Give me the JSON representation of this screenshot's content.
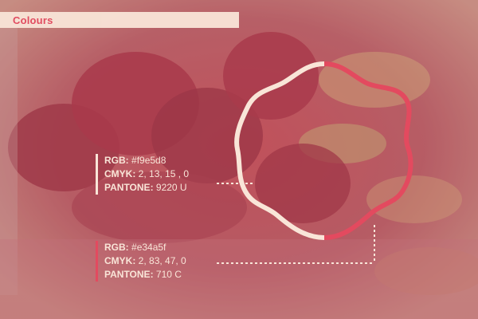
{
  "header": {
    "title": "Colours"
  },
  "swatches": [
    {
      "rgb_label": "RGB:",
      "rgb_value": "#f9e5d8",
      "cmyk_label": "CMYK:",
      "cmyk_value": "2, 13, 15 , 0",
      "pantone_label": "PANTONE:",
      "pantone_value": "9220 U"
    },
    {
      "rgb_label": "RGB:",
      "rgb_value": "#e34a5f",
      "cmyk_label": "CMYK:",
      "cmyk_value": "2, 83, 47, 0",
      "pantone_label": "PANTONE:",
      "pantone_value": "710 C"
    }
  ],
  "colors": {
    "cream": "#f9e5d8",
    "accent": "#e34a5f"
  }
}
